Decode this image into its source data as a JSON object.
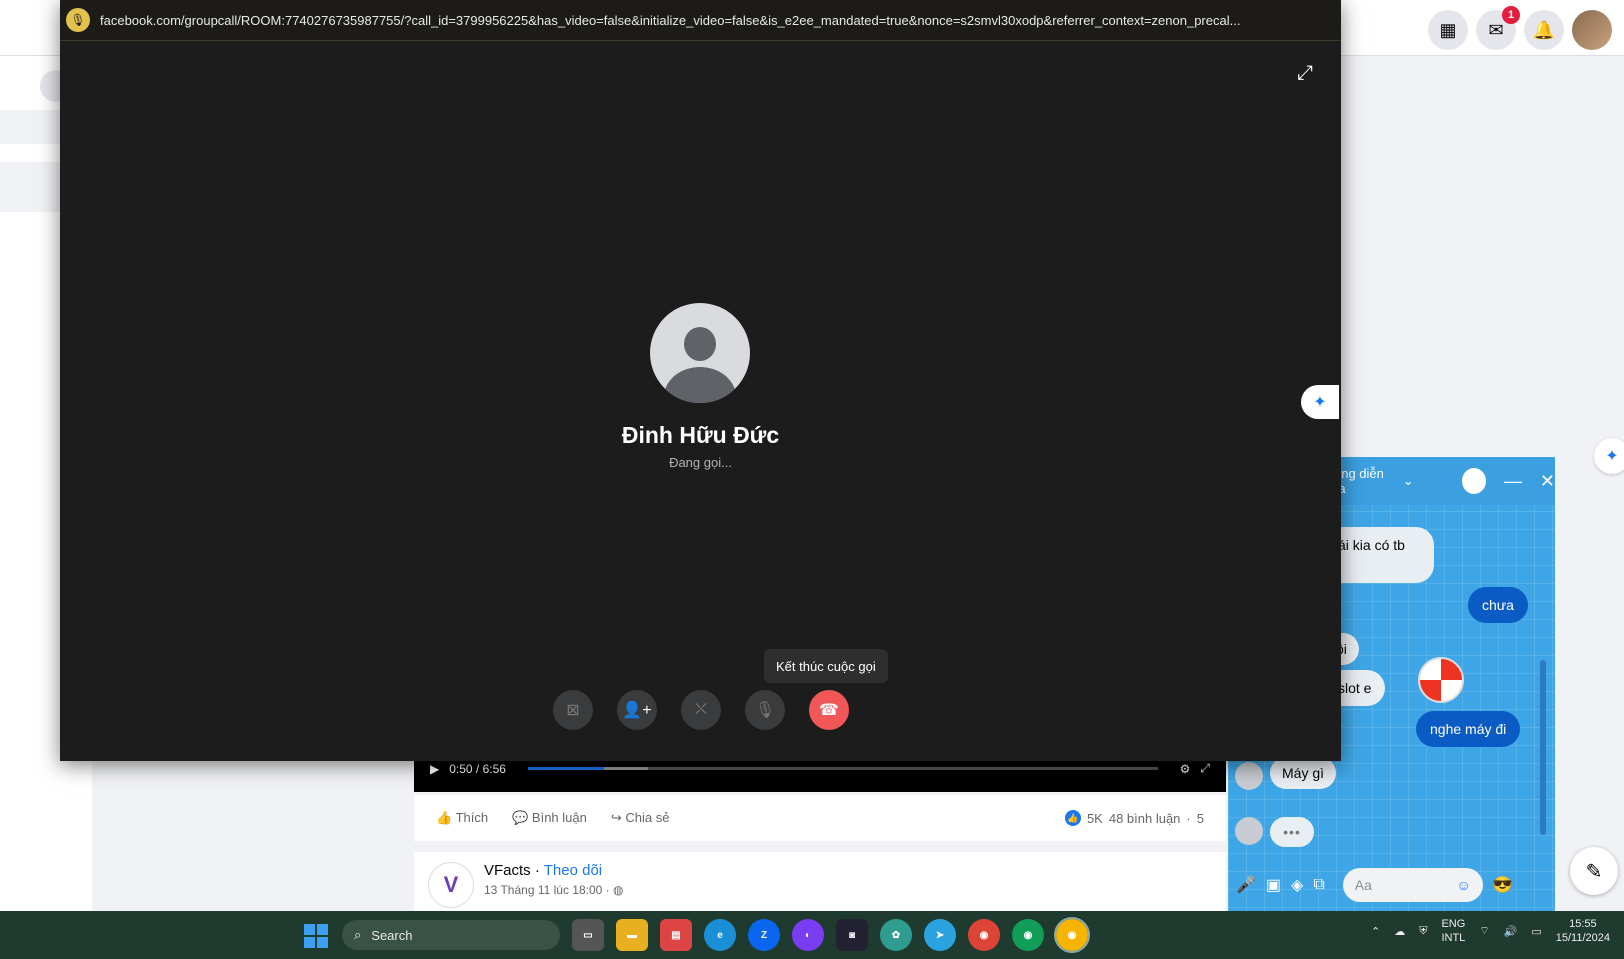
{
  "call": {
    "url": "facebook.com/groupcall/ROOM:7740276735987755/?call_id=3799956225&has_video=false&initialize_video=false&is_e2ee_mandated=true&nonce=s2smvl30xodp&referrer_context=zenon_precal...",
    "caller_name": "Đinh Hữu Đức",
    "status": "Đang gọi...",
    "tooltip": "Kết thúc cuộc gọi"
  },
  "topbar": {
    "messenger_badge": "1"
  },
  "video": {
    "time": "0:50 / 6:56",
    "progress_fraction": 0.12
  },
  "post_actions": {
    "like": "Thích",
    "comment": "Bình luận",
    "share": "Chia sẻ",
    "reactions": "5K",
    "comments_count": "48 bình luận",
    "trailing": "5"
  },
  "post2": {
    "author": "VFacts",
    "follow": "Theo dõi",
    "date": "13 Tháng 11 lúc 18:00"
  },
  "chat": {
    "header": "ang diễn ra",
    "messages": {
      "m1": "ái kia có tb",
      "m2": "chưa",
      "m3": "ôi",
      "m4": "slot e",
      "m5": "nghe máy đi",
      "m6": "Máy gì"
    },
    "input_placeholder": "Aa"
  },
  "taskbar": {
    "search": "Search",
    "lang_top": "ENG",
    "lang_bottom": "INTL",
    "time": "15:55",
    "date": "15/11/2024"
  }
}
